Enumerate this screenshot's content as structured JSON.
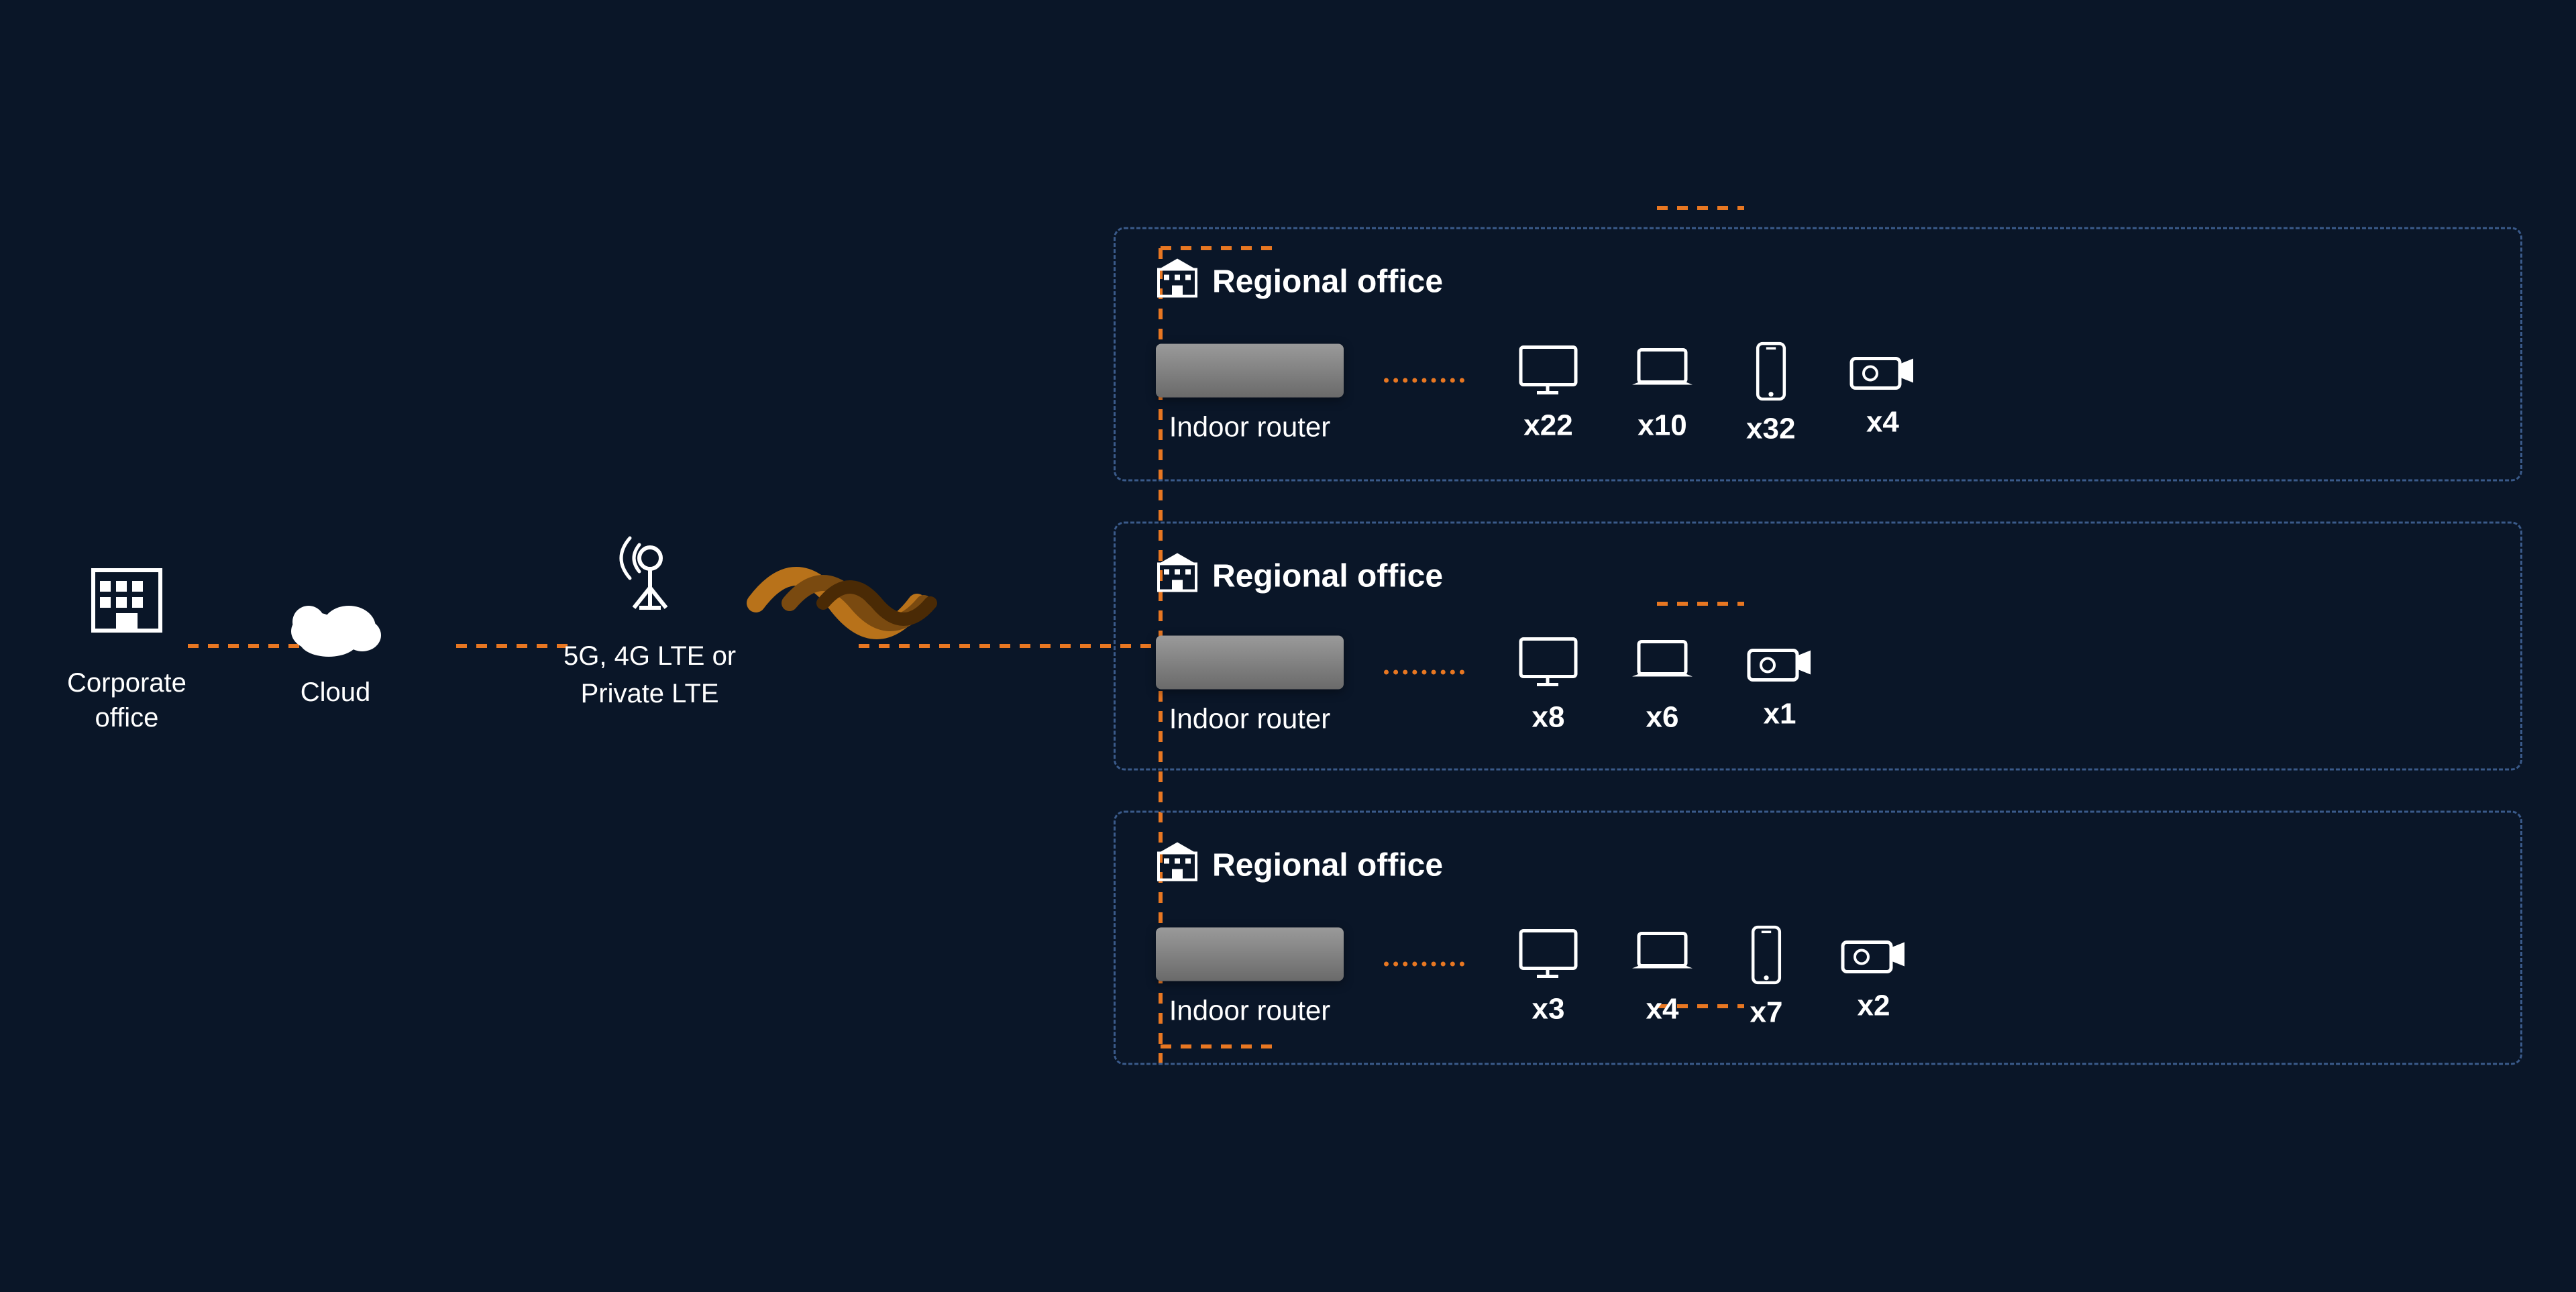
{
  "background_color": "#0a1628",
  "nodes": {
    "corporate": {
      "label": "Corporate\noffice",
      "label_line1": "Corporate",
      "label_line2": "office",
      "icon": "🏢"
    },
    "cloud": {
      "label": "Cloud",
      "icon": "☁"
    },
    "tower": {
      "label_line1": "5G, 4G LTE or",
      "label_line2": "Private LTE",
      "icon": "📡"
    }
  },
  "offices": [
    {
      "id": "office1",
      "title": "Regional office",
      "router_label": "Indoor router",
      "devices": [
        {
          "type": "monitor",
          "count": "x22"
        },
        {
          "type": "laptop",
          "count": "x10"
        },
        {
          "type": "phone",
          "count": "x32"
        },
        {
          "type": "camera",
          "count": "x4"
        }
      ]
    },
    {
      "id": "office2",
      "title": "Regional office",
      "router_label": "Indoor router",
      "devices": [
        {
          "type": "monitor",
          "count": "x8"
        },
        {
          "type": "laptop",
          "count": "x6"
        },
        {
          "type": "camera",
          "count": "x1"
        }
      ]
    },
    {
      "id": "office3",
      "title": "Regional office",
      "router_label": "Indoor router",
      "devices": [
        {
          "type": "monitor",
          "count": "x3"
        },
        {
          "type": "laptop",
          "count": "x4"
        },
        {
          "type": "phone",
          "count": "x7"
        },
        {
          "type": "camera",
          "count": "x2"
        }
      ]
    }
  ],
  "colors": {
    "background": "#0a1628",
    "dotted_line": "#e87722",
    "box_border": "#4a6fa5",
    "text": "#ffffff",
    "router_bg": "#7a7a7a",
    "signal_wave": "#b8721a"
  }
}
